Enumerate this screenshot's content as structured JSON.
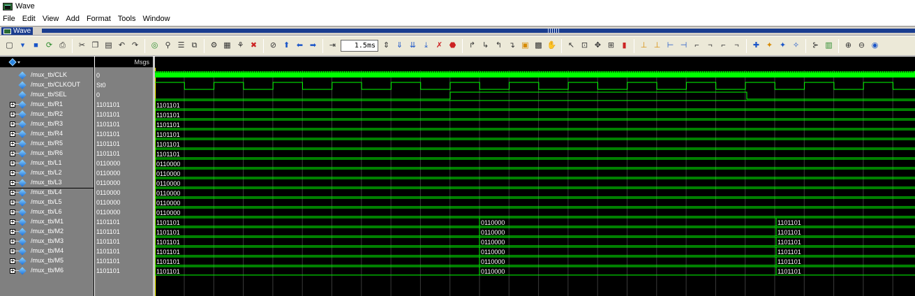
{
  "window": {
    "title": "Wave"
  },
  "menu": [
    "File",
    "Edit",
    "View",
    "Add",
    "Format",
    "Tools",
    "Window"
  ],
  "panel": {
    "tab_label": "Wave"
  },
  "toolbar": {
    "time_value": "1.5ms"
  },
  "columns": {
    "msgs_label": "Msgs"
  },
  "signals": [
    {
      "name": "/mux_tb/CLK",
      "value": "0",
      "expandable": false
    },
    {
      "name": "/mux_tb/CLKOUT",
      "value": "St0",
      "expandable": false
    },
    {
      "name": "/mux_tb/SEL",
      "value": "0",
      "expandable": false
    },
    {
      "name": "/mux_tb/R1",
      "value": "1101101",
      "expandable": true
    },
    {
      "name": "/mux_tb/R2",
      "value": "1101101",
      "expandable": true
    },
    {
      "name": "/mux_tb/R3",
      "value": "1101101",
      "expandable": true
    },
    {
      "name": "/mux_tb/R4",
      "value": "1101101",
      "expandable": true
    },
    {
      "name": "/mux_tb/R5",
      "value": "1101101",
      "expandable": true
    },
    {
      "name": "/mux_tb/R6",
      "value": "1101101",
      "expandable": true
    },
    {
      "name": "/mux_tb/L1",
      "value": "0110000",
      "expandable": true
    },
    {
      "name": "/mux_tb/L2",
      "value": "0110000",
      "expandable": true
    },
    {
      "name": "/mux_tb/L3",
      "value": "0110000",
      "expandable": true
    },
    {
      "name": "/mux_tb/L4",
      "value": "0110000",
      "expandable": true
    },
    {
      "name": "/mux_tb/L5",
      "value": "0110000",
      "expandable": true
    },
    {
      "name": "/mux_tb/L6",
      "value": "0110000",
      "expandable": true
    },
    {
      "name": "/mux_tb/M1",
      "value": "1101101",
      "expandable": true
    },
    {
      "name": "/mux_tb/M2",
      "value": "1101101",
      "expandable": true
    },
    {
      "name": "/mux_tb/M3",
      "value": "1101101",
      "expandable": true
    },
    {
      "name": "/mux_tb/M4",
      "value": "1101101",
      "expandable": true
    },
    {
      "name": "/mux_tb/M5",
      "value": "1101101",
      "expandable": true
    },
    {
      "name": "/mux_tb/M6",
      "value": "1101101",
      "expandable": true
    }
  ],
  "wave_labels": {
    "r_bus": "1101101",
    "l_bus": "0110000",
    "m_seg1": "1101101",
    "m_seg2": "0110000",
    "m_seg3": "1101101"
  },
  "colors": {
    "wave": "#00ff00",
    "cursor": "#ffff00",
    "grid": "#3a3a3a"
  }
}
